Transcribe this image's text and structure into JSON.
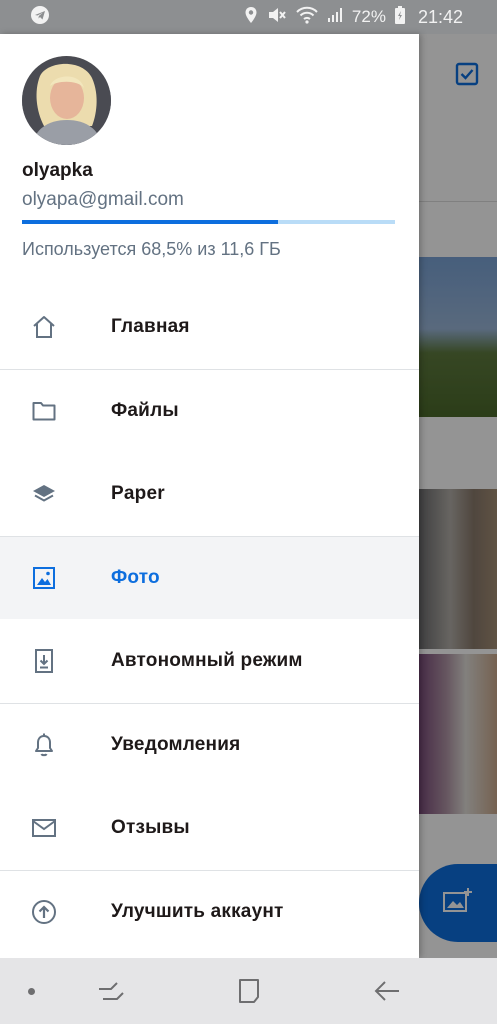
{
  "status_bar": {
    "battery": "72%",
    "time": "21:42",
    "icons": [
      "telegram-icon",
      "location-icon",
      "mute-icon",
      "wifi-icon",
      "signal-icon",
      "battery-icon"
    ]
  },
  "drawer": {
    "username": "olyapka",
    "email": "olyapa@gmail.com",
    "storage_used_fraction": 0.685,
    "storage_text": "Используется 68,5% из 11,6 ГБ",
    "menu": [
      {
        "label": "Главная",
        "icon": "home-icon",
        "active": false
      },
      {
        "label": "Файлы",
        "icon": "folder-icon",
        "active": false
      },
      {
        "label": "Paper",
        "icon": "layers-icon",
        "active": false
      },
      {
        "label": "Фото",
        "icon": "photo-icon",
        "active": true
      },
      {
        "label": "Автономный режим",
        "icon": "offline-icon",
        "active": false
      },
      {
        "label": "Уведомления",
        "icon": "bell-icon",
        "active": false
      },
      {
        "label": "Отзывы",
        "icon": "mail-icon",
        "active": false
      },
      {
        "label": "Улучшить аккаунт",
        "icon": "upgrade-icon",
        "active": false
      }
    ]
  },
  "colors": {
    "accent": "#0d6ede",
    "text": "#1e1919",
    "secondary_text": "#637282",
    "progress_track": "#b9dcf7",
    "active_row": "#f3f4f6"
  },
  "navigation_bar": {
    "buttons": [
      "recent-apps-icon",
      "home-button-icon",
      "back-icon"
    ]
  }
}
